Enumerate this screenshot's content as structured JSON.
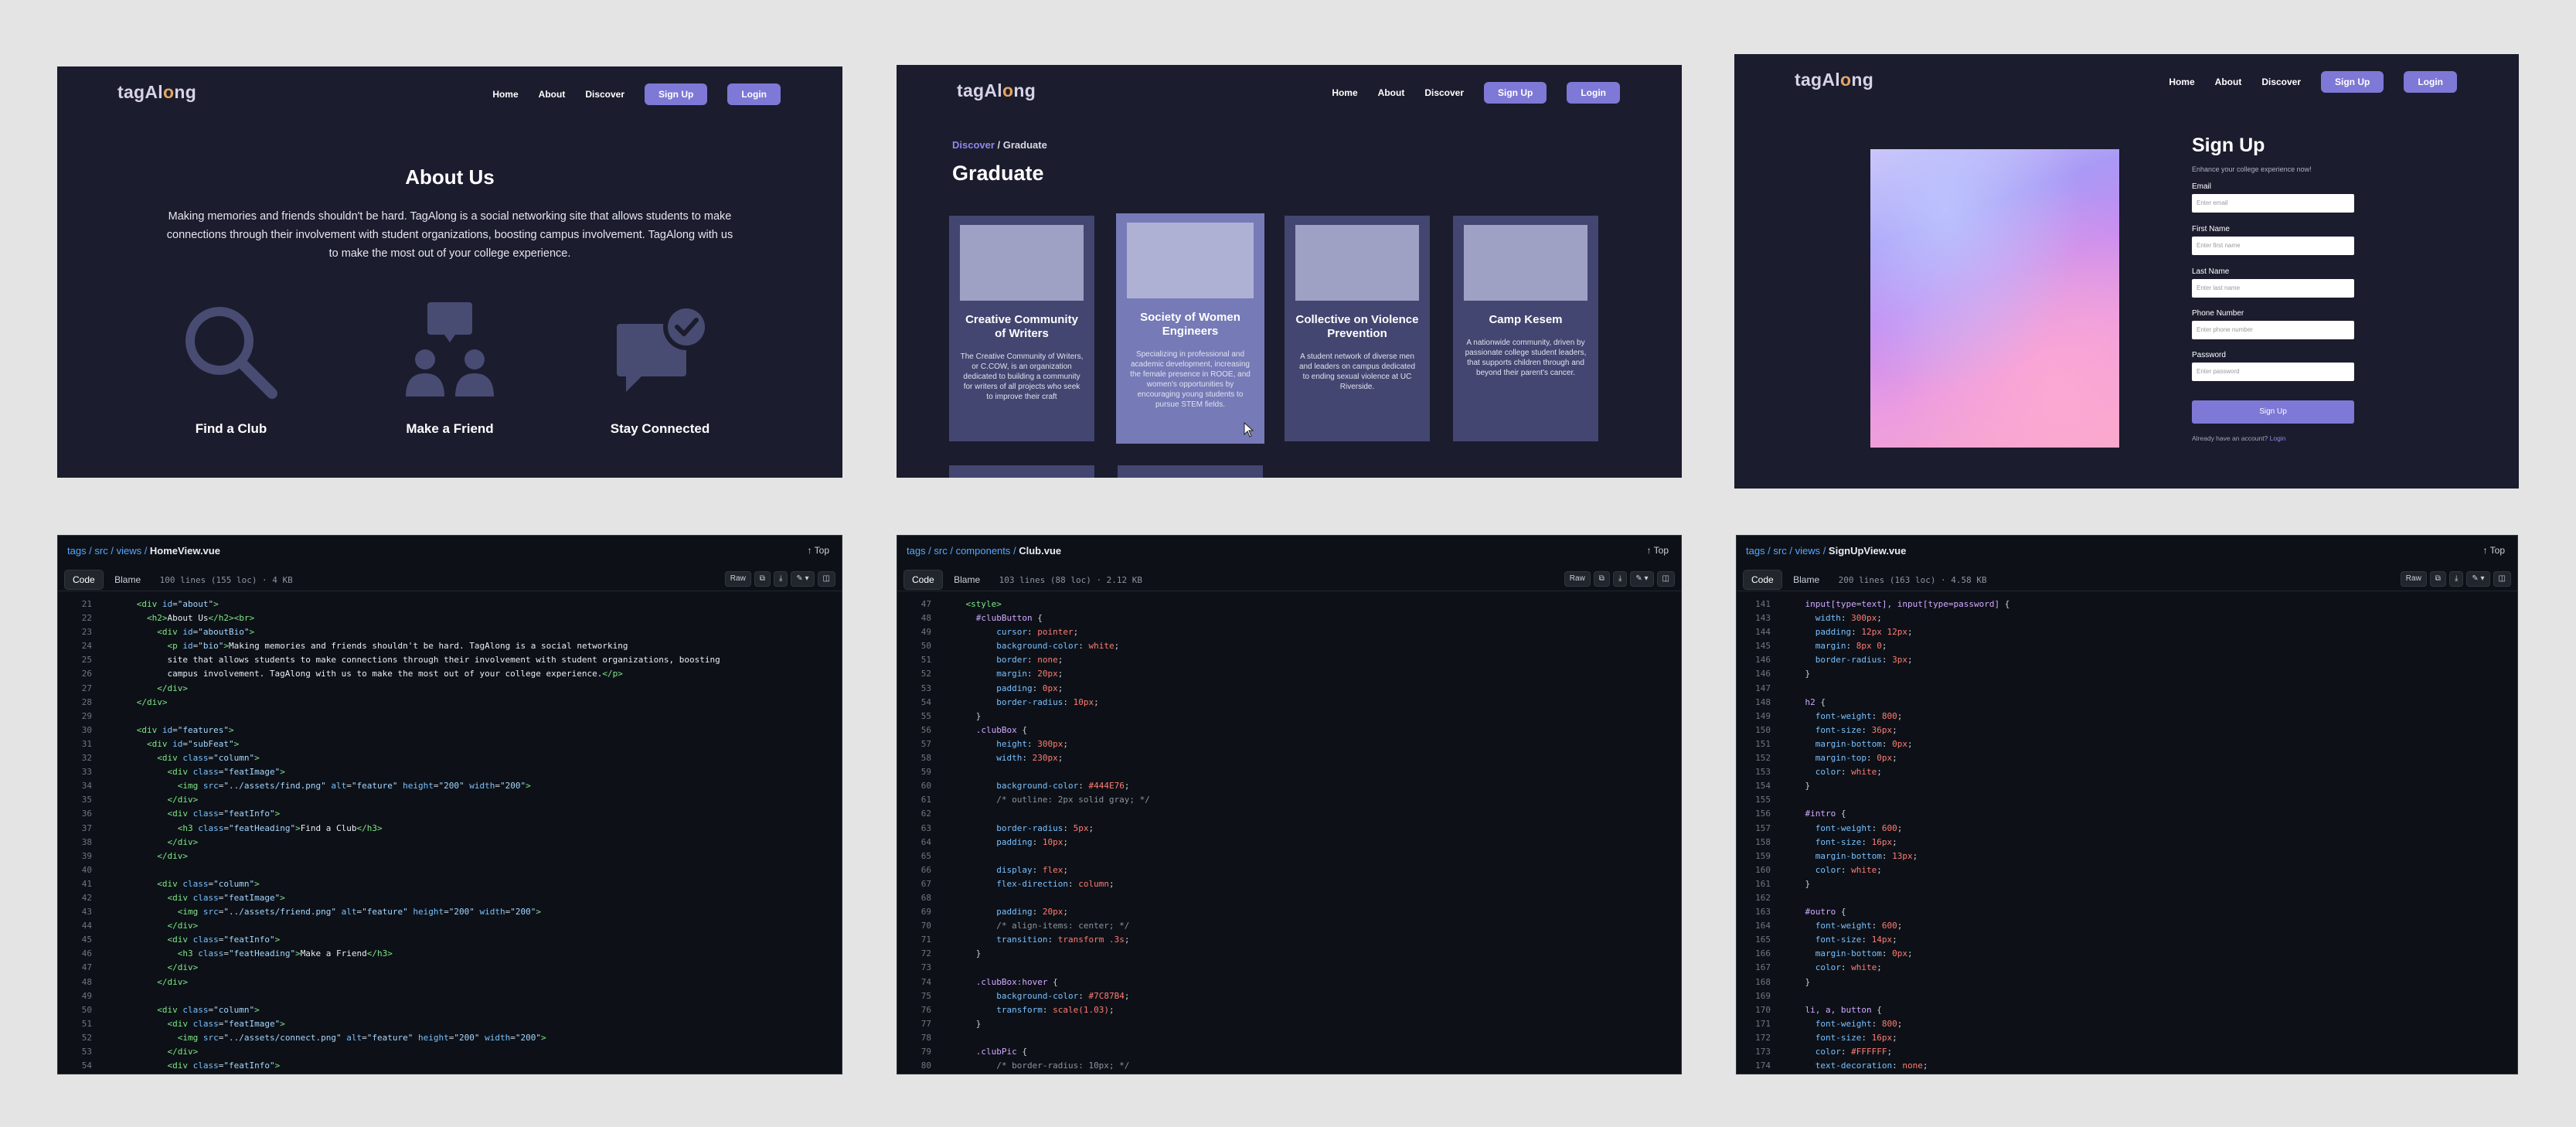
{
  "nav": {
    "logo_a": "tagAl",
    "logo_o": "o",
    "logo_b": "ng",
    "home": "Home",
    "about": "About",
    "discover": "Discover",
    "signup": "Sign Up",
    "login": "Login"
  },
  "about": {
    "title": "About Us",
    "body": "Making memories and friends shouldn't be hard. TagAlong is a social networking site that allows students to make connections through their involvement with student organizations, boosting campus involvement. TagAlong with us to make the most out of your college experience.",
    "features": [
      {
        "label": "Find a Club",
        "icon": "search-icon"
      },
      {
        "label": "Make a Friend",
        "icon": "people-chat-icon"
      },
      {
        "label": "Stay Connected",
        "icon": "chat-check-icon"
      }
    ]
  },
  "graduate": {
    "crumb_a": "Discover",
    "crumb_sep": " / ",
    "crumb_b": "Graduate",
    "title": "Graduate",
    "cards": [
      {
        "name": "Creative Community of Writers",
        "desc": "The Creative Community of Writers, or C.COW, is an organization dedicated to building a community for writers of all projects who seek to improve their craft"
      },
      {
        "name": "Society of Women Engineers",
        "desc": "Specializing in professional and academic development, increasing the female presence in ROOE, and women's opportunities by encouraging young students to pursue STEM fields."
      },
      {
        "name": "Collective on Violence Prevention",
        "desc": "A student network of diverse men and leaders on campus dedicated to ending sexual violence at UC Riverside."
      },
      {
        "name": "Camp Kesem",
        "desc": "A nationwide community, driven by passionate college student leaders, that supports children through and beyond their parent's cancer."
      }
    ]
  },
  "signup": {
    "title": "Sign Up",
    "subtitle": "Enhance your college experience now!",
    "fields": [
      {
        "label": "Email",
        "placeholder": "Enter email"
      },
      {
        "label": "First Name",
        "placeholder": "Enter first name"
      },
      {
        "label": "Last Name",
        "placeholder": "Enter last name"
      },
      {
        "label": "Phone Number",
        "placeholder": "Enter phone number"
      },
      {
        "label": "Password",
        "placeholder": "Enter password"
      }
    ],
    "button": "Sign Up",
    "footer": "Already have an account?",
    "footer_link": "Login"
  },
  "code": {
    "top": "Top",
    "tab_code": "Code",
    "tab_blame": "Blame",
    "raw": "Raw",
    "files": [
      {
        "path": "tags / src / views / ",
        "file": "HomeView.vue",
        "meta": "100 lines (155 loc) · 4 KB"
      },
      {
        "path": "tags / src / components / ",
        "file": "Club.vue",
        "meta": "103 lines (88 loc) · 2.12 KB"
      },
      {
        "path": "tags / src / views / ",
        "file": "SignUpView.vue",
        "meta": "200 lines (163 loc) · 4.58 KB"
      }
    ]
  }
}
